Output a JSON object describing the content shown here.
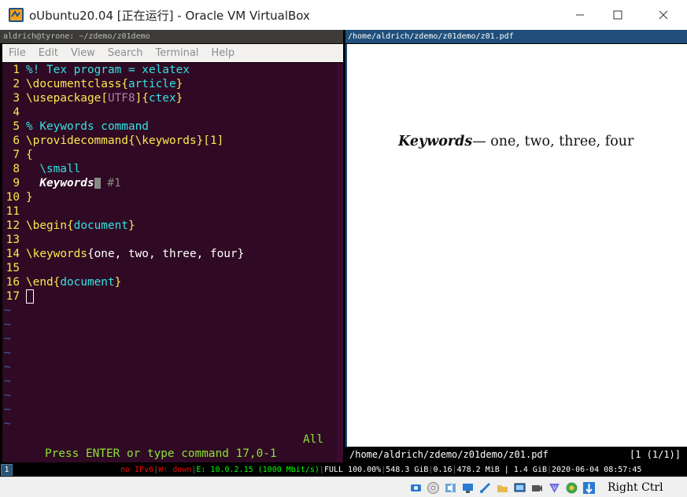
{
  "window": {
    "title": "oUbuntu20.04 [正在运行] - Oracle VM VirtualBox",
    "icon": "virtualbox-app-icon",
    "controls": [
      "minimize-icon",
      "maximize-icon",
      "close-icon"
    ]
  },
  "terminal": {
    "title": "aldrich@tyrone: ~/zdemo/z01demo",
    "menu": [
      "File",
      "Edit",
      "View",
      "Search",
      "Terminal",
      "Help"
    ],
    "lines": [
      {
        "n": "1",
        "parts": [
          {
            "t": "%! Tex program = xelatex",
            "c": "comment"
          }
        ]
      },
      {
        "n": "2",
        "parts": [
          {
            "t": "\\documentclass",
            "c": "cmd"
          },
          {
            "t": "{",
            "c": "brace"
          },
          {
            "t": "article",
            "c": "argc"
          },
          {
            "t": "}",
            "c": "brace"
          }
        ]
      },
      {
        "n": "3",
        "parts": [
          {
            "t": "\\usepackage",
            "c": "cmd"
          },
          {
            "t": "[",
            "c": "brace"
          },
          {
            "t": "UTF8",
            "c": "optc"
          },
          {
            "t": "]{",
            "c": "brace"
          },
          {
            "t": "ctex",
            "c": "argc"
          },
          {
            "t": "}",
            "c": "brace"
          }
        ]
      },
      {
        "n": "4",
        "parts": []
      },
      {
        "n": "5",
        "parts": [
          {
            "t": "% Keywords command",
            "c": "comment"
          }
        ]
      },
      {
        "n": "6",
        "parts": [
          {
            "t": "\\providecommand",
            "c": "cmd"
          },
          {
            "t": "{",
            "c": "brace"
          },
          {
            "t": "\\keywords",
            "c": "cmd"
          },
          {
            "t": "}",
            "c": "brace"
          },
          {
            "t": "[1]",
            "c": "brace"
          }
        ]
      },
      {
        "n": "7",
        "parts": [
          {
            "t": "{",
            "c": "brace"
          }
        ]
      },
      {
        "n": "8",
        "parts": [
          {
            "t": "  \\small",
            "c": "argc"
          }
        ]
      },
      {
        "n": "9",
        "parts": [
          {
            "t": "  ",
            "c": "code"
          },
          {
            "t": "Keywords",
            "c": "boldit"
          },
          {
            "t": "—",
            "c": "cursorfill"
          },
          {
            "t": " #1",
            "c": "dim"
          }
        ]
      },
      {
        "n": "10",
        "parts": [
          {
            "t": "}",
            "c": "brace"
          }
        ]
      },
      {
        "n": "11",
        "parts": []
      },
      {
        "n": "12",
        "parts": [
          {
            "t": "\\begin",
            "c": "cmd"
          },
          {
            "t": "{",
            "c": "brace"
          },
          {
            "t": "document",
            "c": "argc"
          },
          {
            "t": "}",
            "c": "brace"
          }
        ]
      },
      {
        "n": "13",
        "parts": []
      },
      {
        "n": "14",
        "parts": [
          {
            "t": "\\keywords",
            "c": "cmd"
          },
          {
            "t": "{one, two, three, four}",
            "c": "code"
          }
        ]
      },
      {
        "n": "15",
        "parts": []
      },
      {
        "n": "16",
        "parts": [
          {
            "t": "\\end",
            "c": "cmd"
          },
          {
            "t": "{",
            "c": "brace"
          },
          {
            "t": "document",
            "c": "argc"
          },
          {
            "t": "}",
            "c": "brace"
          }
        ]
      },
      {
        "n": "17",
        "parts": [
          {
            "t": "",
            "c": "cursor"
          }
        ]
      }
    ],
    "tildes": [
      "~",
      "~",
      "~",
      "~",
      "~",
      "~",
      "~",
      "~",
      "~"
    ],
    "status_message": "Press ENTER or type command",
    "status_position": "17,0-1",
    "status_scroll": "All"
  },
  "pdf": {
    "title": "/home/aldrich/zdemo/z01demo/z01.pdf",
    "keyword_label": "Keywords",
    "keyword_rest": "— one, two, three, four",
    "footer_path": "/home/aldrich/zdemo/z01demo/z01.pdf",
    "footer_page": "[1 (1/1)]"
  },
  "i3bar": {
    "workspace": "1",
    "ipv6": "no IPv6",
    "wifi": "W: down",
    "eth": "E: 10.0.2.15 (1000 Mbit/s)",
    "battery": "FULL 100.00%",
    "disk": "548.3 GiB",
    "load": "0.16",
    "memory": "478.2 MiB | 1.4 GiB",
    "datetime": "2020-06-04 08:57:45"
  },
  "vbox": {
    "host_key": "Right Ctrl"
  },
  "colors": {
    "terminal_bg": "#300a24",
    "pdf_titlebar": "#1f4f7a",
    "line_number": "#fce94f",
    "status_green": "#8ae234"
  }
}
